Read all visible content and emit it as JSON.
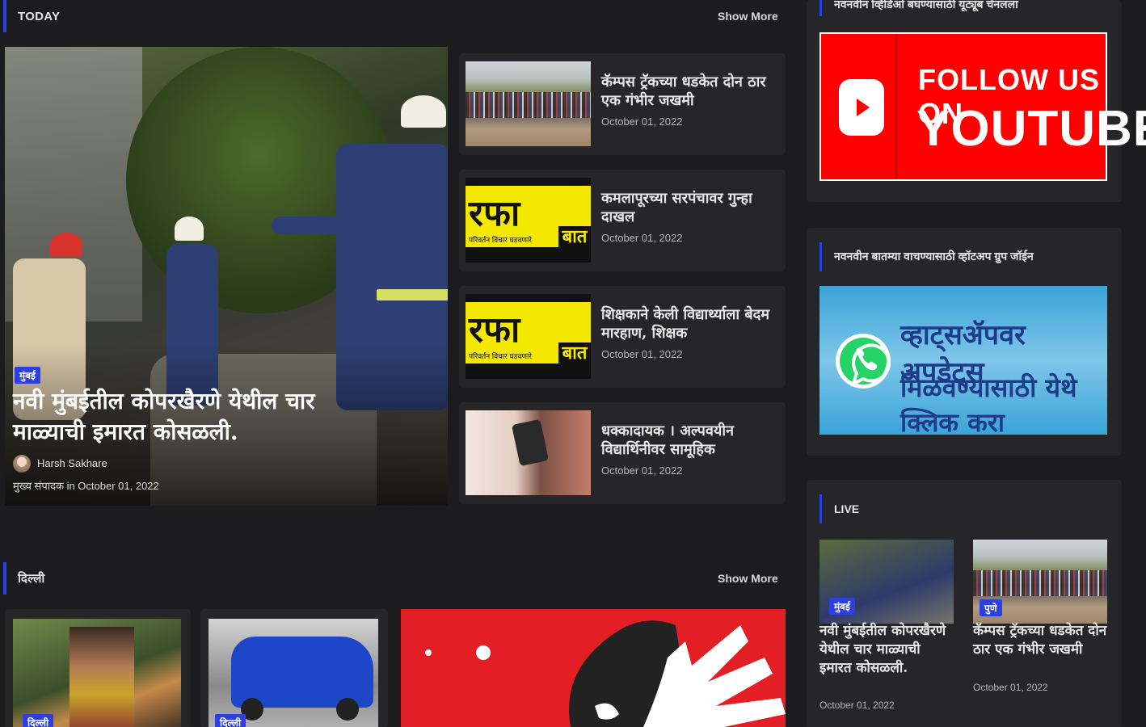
{
  "today": {
    "title": "TODAY",
    "show_more": "Show More",
    "featured": {
      "category": "मुंबई",
      "title": "नवी मुंबईतील कोपरखैरणे येथील चार माळ्याची इमारत कोसळली.",
      "author": "Harsh Sakhare",
      "meta": "मुख्य संपादक in October 01, 2022"
    },
    "items": [
      {
        "title": "कॅम्पस ट्रॅकच्या धडकेत दोन ठार एक गंभीर जखमी",
        "date": "October 01, 2022"
      },
      {
        "title": "कमलापूरच्या सरपंचावर गुन्हा दाखल",
        "date": "October 01, 2022"
      },
      {
        "title": "शिक्षकाने केली विद्यार्थ्याला बेदम मारहाण, शिक्षक",
        "date": "October 01, 2022"
      },
      {
        "title": "धक्कादायक । अल्पवयीन विद्यार्थिनीवर सामूहिक",
        "date": "October 01, 2022"
      }
    ],
    "logo_text": "रफा",
    "logo_sub": "परिवर्तन विचार घडवणारे",
    "logo_side": "बात"
  },
  "sidebar": {
    "top_heading": "नवनवीन व्हिडिओ बघण्यासाठी यूट्यूब चॅनलला",
    "youtube": {
      "line1": "FOLLOW US ON",
      "line2": "YOUTUBE"
    },
    "whatsapp_heading": "नवनवीन बातम्या वाचण्यासाठी व्हॉटअप ग्रुप जॉईन",
    "whatsapp": {
      "line1": "व्हाट्सॲपवर अपडेट्स",
      "line2": "मिळवण्यासाठी येथे क्लिक करा"
    },
    "live": {
      "title": "LIVE",
      "items": [
        {
          "category": "मुंबई",
          "title": "नवी मुंबईतील कोपरखैरणे येथील चार माळ्याची इमारत कोसळली.",
          "date": "October 01, 2022"
        },
        {
          "category": "पुणे",
          "title": "कॅम्पस ट्रॅकच्या धडकेत दोन ठार एक गंभीर जखमी",
          "date": "October 01, 2022"
        }
      ]
    }
  },
  "delhi": {
    "title": "दिल्ली",
    "show_more": "Show More",
    "cards": [
      {
        "category": "दिल्ली"
      },
      {
        "category": "दिल्ली"
      }
    ]
  }
}
